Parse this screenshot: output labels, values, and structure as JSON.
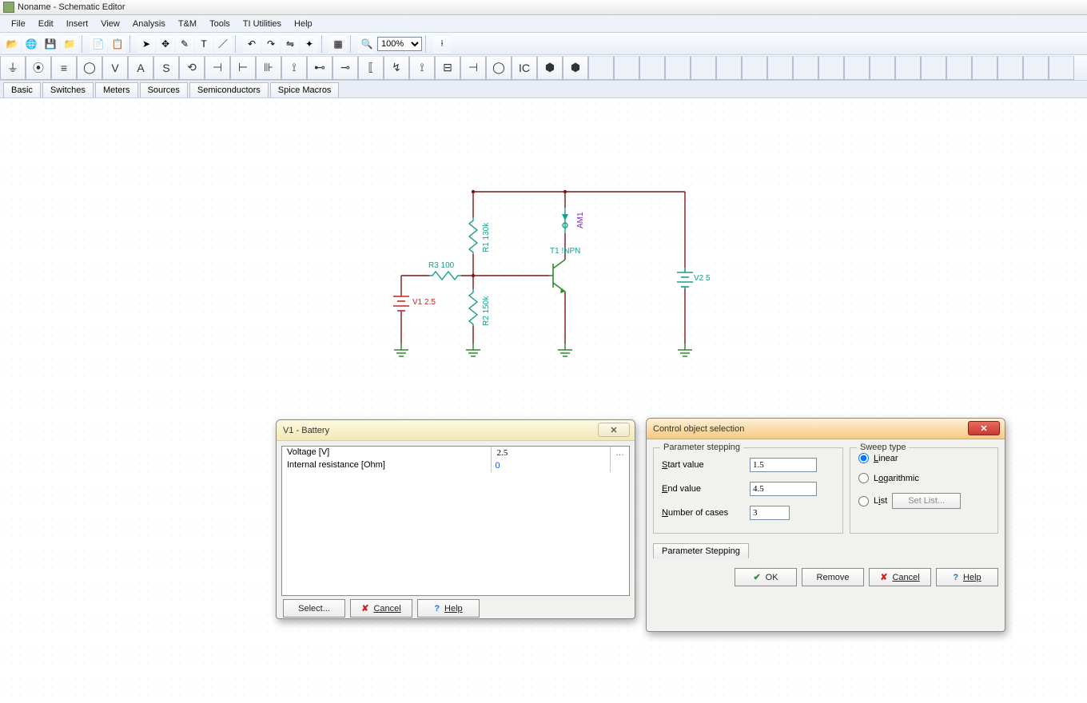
{
  "app_title": "Noname - Schematic Editor",
  "menu": [
    "File",
    "Edit",
    "Insert",
    "View",
    "Analysis",
    "T&M",
    "Tools",
    "TI Utilities",
    "Help"
  ],
  "zoom_value": "100%",
  "component_glyphs": [
    "⏚",
    "⦿",
    "≡",
    "◯",
    "V",
    "A",
    "S",
    "⟲",
    "⊣",
    "⊢",
    "⊪",
    "⟟",
    "⊷",
    "⊸",
    "⟦",
    "↯",
    "⟟",
    "⊟",
    "⊣",
    "◯",
    "IC",
    "⬢",
    "⬢"
  ],
  "tabs": [
    "Basic",
    "Switches",
    "Meters",
    "Sources",
    "Semiconductors",
    "Spice Macros"
  ],
  "schematic": {
    "v1": "V1 2.5",
    "r3": "R3 100",
    "r1": "R1 130k",
    "r2": "R2 150k",
    "t1": "T1 !NPN",
    "am1": "AM1",
    "v2": "V2 5"
  },
  "v1dialog": {
    "title": "V1 - Battery",
    "close": "✕",
    "rows": [
      {
        "label": "Voltage [V]",
        "value": "2.5",
        "more": true
      },
      {
        "label": "Internal resistance [Ohm]",
        "value": "0",
        "blue": true
      }
    ],
    "select_btn": "Select...",
    "cancel_btn": "Cancel",
    "help_btn": "Help"
  },
  "ctrldialog": {
    "title": "Control object selection",
    "fs_parameter": "Parameter stepping",
    "start_label": "Start value",
    "start_value": "1.5",
    "end_label": "End value",
    "end_value": "4.5",
    "cases_label": "Number of cases",
    "cases_value": "3",
    "fs_sweep": "Sweep type",
    "opt_linear": "Linear",
    "opt_log": "Logarithmic",
    "opt_list": "List",
    "setlist_btn": "Set List...",
    "bottom_tab": "Parameter Stepping",
    "ok_btn": "OK",
    "remove_btn": "Remove",
    "cancel_btn": "Cancel",
    "help_btn": "Help"
  }
}
